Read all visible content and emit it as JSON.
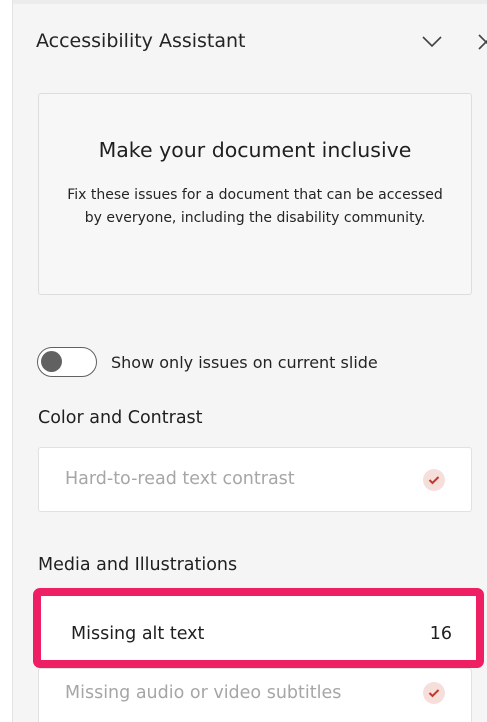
{
  "pane": {
    "title": "Accessibility Assistant",
    "collapse_icon": "chevron-down-icon",
    "close_icon": "close-icon"
  },
  "intro": {
    "title": "Make your document inclusive",
    "description": "Fix these issues for a document that can be accessed by everyone, including the disability community."
  },
  "toggle": {
    "label": "Show only issues on current slide",
    "state": "off"
  },
  "sections": [
    {
      "heading": "Color and Contrast",
      "issues": [
        {
          "label": "Hard-to-read text contrast",
          "status_icon": "check-circle-icon",
          "resolved": true
        }
      ]
    },
    {
      "heading": "Media and Illustrations",
      "issues": [
        {
          "label": "Missing alt text",
          "count": "16",
          "highlighted": true
        },
        {
          "label": "Missing audio or video subtitles",
          "status_icon": "check-circle-icon",
          "resolved": true
        }
      ]
    }
  ],
  "colors": {
    "highlight": "#ee1f63",
    "check": "#c0392b",
    "check_bg": "#f6dedb",
    "pane_bg": "#f5f5f5"
  }
}
